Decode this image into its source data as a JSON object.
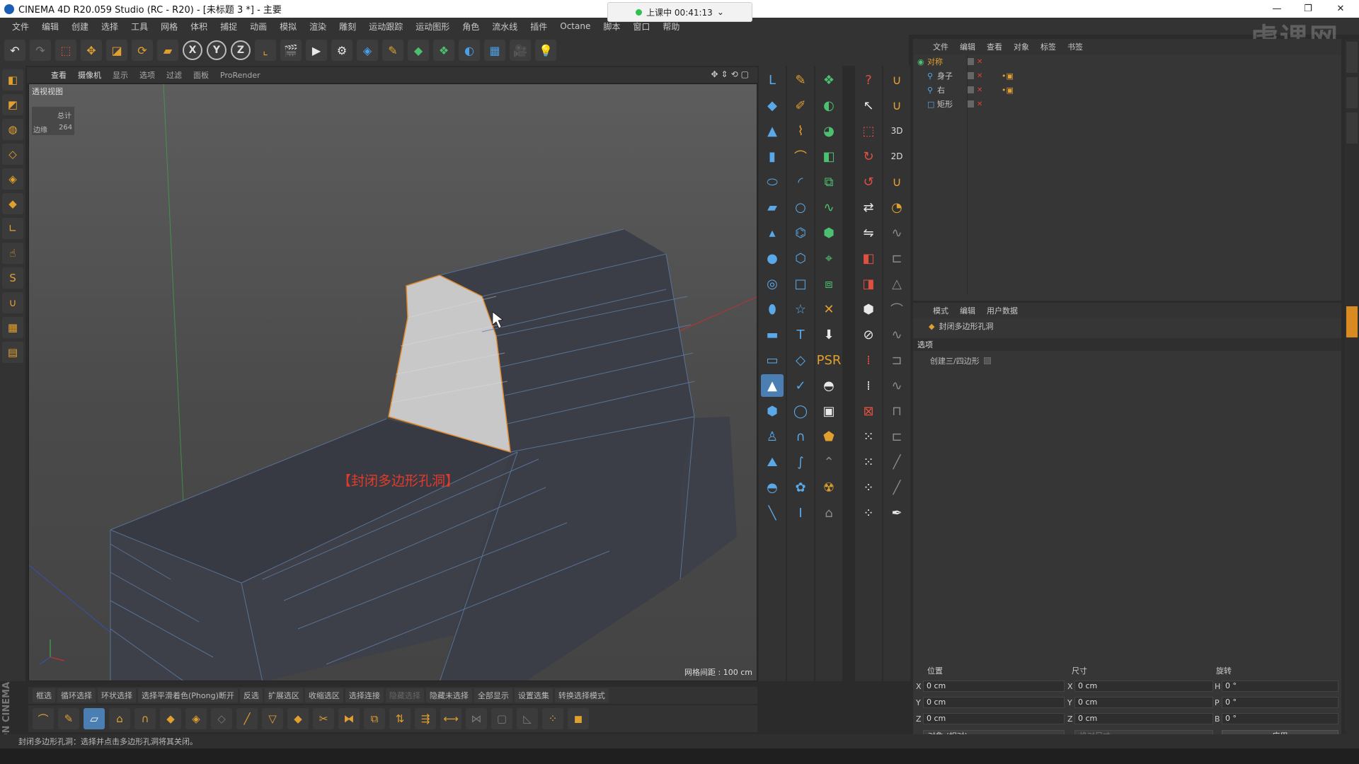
{
  "window": {
    "title": "CINEMA 4D R20.059 Studio (RC - R20) - [未标题 3 *] - 主要",
    "recording_label": "上课中 00:41:13",
    "minimize": "—",
    "maximize": "❐",
    "close": "✕"
  },
  "watermark": "虎课网",
  "menu": [
    "文件",
    "编辑",
    "创建",
    "选择",
    "工具",
    "网格",
    "体积",
    "捕捉",
    "动画",
    "模拟",
    "渲染",
    "雕刻",
    "运动跟踪",
    "运动图形",
    "角色",
    "流水线",
    "插件",
    "Octane",
    "脚本",
    "窗口",
    "帮助"
  ],
  "viewport_menu": [
    "查看",
    "摄像机",
    "显示",
    "选项",
    "过滤",
    "面板",
    "ProRender"
  ],
  "viewport": {
    "label": "透视视图",
    "hud_total": "总计",
    "hud_edges_label": "边缘",
    "hud_edges_value": "264",
    "caption": "【封闭多边形孔洞】",
    "grid_spacing": "网格间距 : 100 cm",
    "axis_x": "X",
    "axis_y": "Y",
    "axis_z": "Z"
  },
  "selection_tools": [
    {
      "label": "框选",
      "enabled": true
    },
    {
      "label": "循环选择",
      "enabled": true
    },
    {
      "label": "环状选择",
      "enabled": true
    },
    {
      "label": "选择平滑着色(Phong)断开",
      "enabled": true
    },
    {
      "label": "反选",
      "enabled": true
    },
    {
      "label": "扩展选区",
      "enabled": true
    },
    {
      "label": "收缩选区",
      "enabled": true
    },
    {
      "label": "选择连接",
      "enabled": true
    },
    {
      "label": "隐藏选择",
      "enabled": false
    },
    {
      "label": "隐藏未选择",
      "enabled": true
    },
    {
      "label": "全部显示",
      "enabled": true
    },
    {
      "label": "设置选集",
      "enabled": true
    },
    {
      "label": "转换选择模式",
      "enabled": true
    }
  ],
  "status": "封闭多边形孔洞：选择并点击多边形孔洞将其关闭。",
  "object_manager": {
    "menu": [
      "文件",
      "编辑",
      "查看",
      "对象",
      "标签",
      "书签"
    ],
    "objects": [
      {
        "name": "对称",
        "indent": 0
      },
      {
        "name": "身子",
        "indent": 1
      },
      {
        "name": "右",
        "indent": 1
      },
      {
        "name": "矩形",
        "indent": 1
      }
    ]
  },
  "attributes": {
    "menu": [
      "模式",
      "编辑",
      "用户数据"
    ],
    "tool_name": "封闭多边形孔洞",
    "section": "选项",
    "option_label": "创建三/四边形"
  },
  "coordinates": {
    "headers": [
      "位置",
      "尺寸",
      "旋转"
    ],
    "rows": [
      {
        "axis": "X",
        "pos": "0 cm",
        "size_axis": "X",
        "size": "0 cm",
        "rot_axis": "H",
        "rot": "0 °"
      },
      {
        "axis": "Y",
        "pos": "0 cm",
        "size_axis": "Y",
        "size": "0 cm",
        "rot_axis": "P",
        "rot": "0 °"
      },
      {
        "axis": "Z",
        "pos": "0 cm",
        "size_axis": "Z",
        "size": "0 cm",
        "rot_axis": "B",
        "rot": "0 °"
      }
    ],
    "mode": "对象 (相对)",
    "size_mode": "绝对尺寸",
    "apply": "应用"
  },
  "colors": {
    "accent_orange": "#e0a030",
    "selection_blue": "#4b7fb3",
    "caption_red": "#e53a2a",
    "rec_green": "#2fbf4f"
  },
  "toolbar_icons": [
    "undo-icon",
    "redo-icon",
    "live-select-icon",
    "move-icon",
    "scale-icon",
    "rotate-icon",
    "recent-tool-icon",
    "x-axis-icon",
    "y-axis-icon",
    "z-axis-icon",
    "world-coord-icon",
    "render-view-icon",
    "render-picture-icon",
    "render-settings-icon",
    "cube-icon",
    "pen-icon",
    "subdivide-icon",
    "cloner-icon",
    "deformer-icon",
    "floor-icon",
    "camera-icon",
    "light-icon"
  ],
  "viewport_hole_present": true
}
